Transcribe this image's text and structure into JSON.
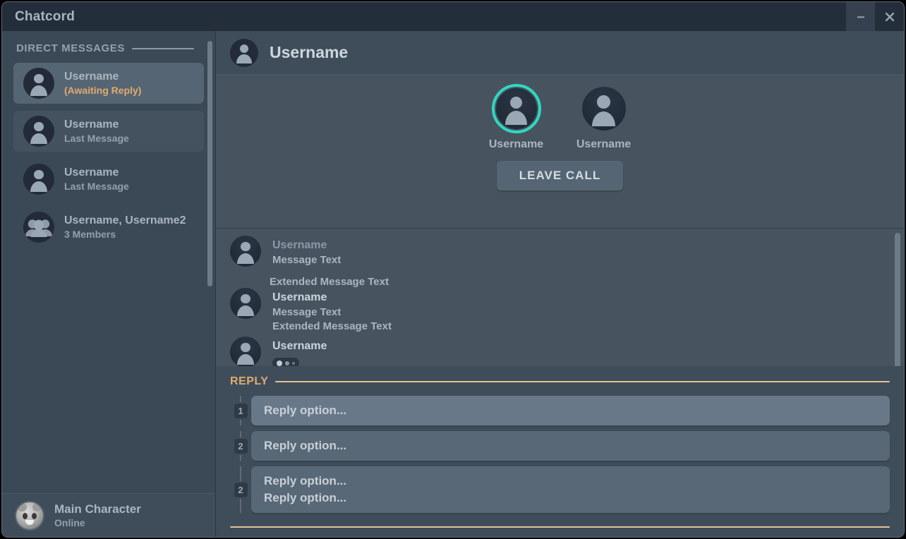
{
  "window": {
    "title": "Chatcord",
    "controls": [
      {
        "name": "minimize",
        "glyph": "minimize-icon",
        "hovered": true
      },
      {
        "name": "close",
        "glyph": "close-icon",
        "hovered": false
      }
    ]
  },
  "sidebar": {
    "section_label": "DIRECT MESSAGES",
    "conversations": [
      {
        "name": "Username",
        "subtitle": "(Awaiting Reply)",
        "state": "selected",
        "subtitle_style": "awaiting",
        "avatar": "person"
      },
      {
        "name": "Username",
        "subtitle": "Last Message",
        "state": "subtle",
        "subtitle_style": "normal",
        "avatar": "person"
      },
      {
        "name": "Username",
        "subtitle": "Last Message",
        "state": "plain",
        "subtitle_style": "normal",
        "avatar": "person"
      },
      {
        "name": "Username, Username2",
        "subtitle": "3 Members",
        "state": "plain",
        "subtitle_style": "normal",
        "avatar": "group"
      }
    ],
    "user": {
      "name": "Main Character",
      "status": "Online",
      "avatar": "main-character-portrait"
    }
  },
  "chat": {
    "header": {
      "title": "Username",
      "avatar": "person"
    },
    "call": {
      "participants": [
        {
          "name": "Username",
          "speaking": true
        },
        {
          "name": "Username",
          "speaking": false
        }
      ],
      "leave_button_label": "LEAVE CALL",
      "speaking_ring_color": "#2fd8c0"
    },
    "messages": [
      {
        "author": "Username",
        "author_style": "dim",
        "lines": [
          "Message Text"
        ],
        "extended": "Extended Message Text",
        "extended_detached": true,
        "typing": false
      },
      {
        "author": "Username",
        "author_style": "bright",
        "lines": [
          "Message Text",
          "Extended Message Text"
        ],
        "extended": null,
        "extended_detached": false,
        "typing": false
      },
      {
        "author": "Username",
        "author_style": "bright",
        "lines": [],
        "extended": null,
        "extended_detached": false,
        "typing": true
      }
    ]
  },
  "reply": {
    "section_label": "REPLY",
    "accent_color": "#e0ab6d",
    "options": [
      {
        "key": "1",
        "lines": [
          "Reply option..."
        ],
        "highlighted": true
      },
      {
        "key": "2",
        "lines": [
          "Reply option..."
        ],
        "highlighted": false
      },
      {
        "key": "2",
        "lines": [
          "Reply option...",
          "Reply option..."
        ],
        "highlighted": false
      }
    ]
  }
}
